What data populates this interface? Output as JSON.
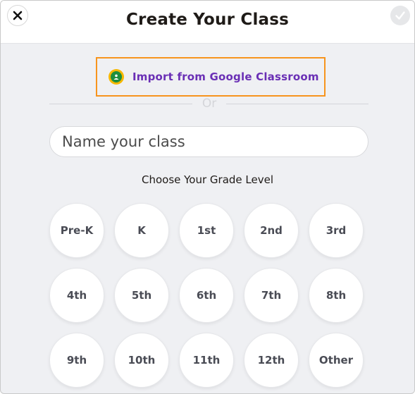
{
  "header": {
    "title": "Create Your Class"
  },
  "import": {
    "label": "Import from Google Classroom"
  },
  "divider": {
    "text": "Or"
  },
  "class_name": {
    "placeholder": "Name your class",
    "value": ""
  },
  "grades": {
    "heading": "Choose Your Grade Level",
    "options": [
      "Pre-K",
      "K",
      "1st",
      "2nd",
      "3rd",
      "4th",
      "5th",
      "6th",
      "7th",
      "8th",
      "9th",
      "10th",
      "11th",
      "12th",
      "Other"
    ]
  },
  "colors": {
    "import_border": "#f7941d",
    "import_text": "#6a2fb5",
    "background": "#eff0f3"
  }
}
